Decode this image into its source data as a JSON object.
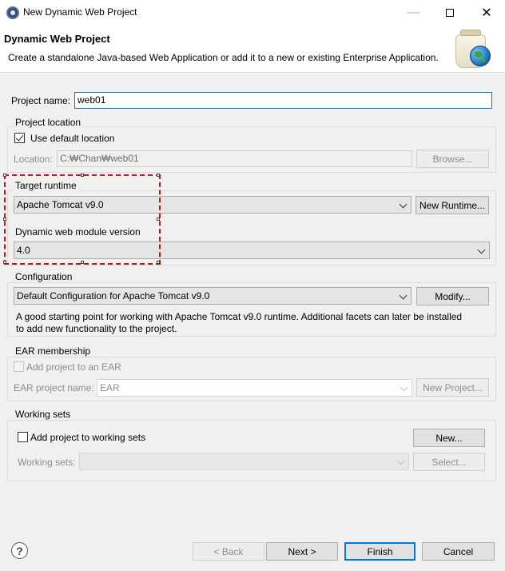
{
  "window": {
    "title": "New Dynamic Web Project"
  },
  "banner": {
    "title": "Dynamic Web Project",
    "description": "Create a standalone Java-based Web Application or add it to a new or existing Enterprise Application."
  },
  "project": {
    "name_label": "Project name:",
    "name_value": "web01"
  },
  "location": {
    "group_label": "Project location",
    "use_default_label": "Use default location",
    "use_default_checked": true,
    "location_label": "Location:",
    "location_value": "C:₩Chan₩web01",
    "browse_label": "Browse..."
  },
  "runtime": {
    "label": "Target runtime",
    "value": "Apache Tomcat v9.0",
    "new_runtime_label": "New Runtime..."
  },
  "module": {
    "label": "Dynamic web module version",
    "value": "4.0"
  },
  "configuration": {
    "label": "Configuration",
    "value": "Default Configuration for Apache Tomcat v9.0",
    "modify_label": "Modify...",
    "desc_line1": "A good starting point for working with Apache Tomcat v9.0 runtime. Additional facets can later be installed",
    "desc_line2": "to add new functionality to the project."
  },
  "ear": {
    "label": "EAR membership",
    "add_label": "Add project to an EAR",
    "add_checked": false,
    "project_name_label": "EAR project name:",
    "project_name_value": "EAR",
    "new_project_label": "New Project..."
  },
  "working_sets": {
    "label": "Working sets",
    "add_label": "Add project to working sets",
    "add_checked": false,
    "new_label": "New...",
    "sets_label": "Working sets:",
    "sets_value": "",
    "select_label": "Select..."
  },
  "footer": {
    "help_glyph": "?",
    "back_label": "< Back",
    "next_label": "Next >",
    "finish_label": "Finish",
    "cancel_label": "Cancel"
  },
  "colors": {
    "highlight": "#c4161c",
    "focus": "#0078d7",
    "dialog_bg": "#f0f0f0"
  },
  "icons": [
    "eclipse-icon",
    "minimize-icon",
    "maximize-icon",
    "close-icon",
    "jar-globe-icon",
    "checkmark-icon",
    "chevron-down-icon",
    "help-icon"
  ]
}
